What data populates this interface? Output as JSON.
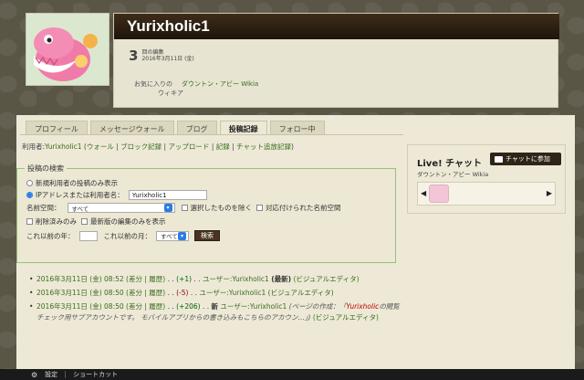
{
  "profile": {
    "username": "Yurixholic1",
    "edit_count": "3",
    "edit_label_line1": "回の編集",
    "edit_label_line2": "2016年3月11日 (金)",
    "favorite_label_line1": "お気に入りの",
    "favorite_label_line2": "ウィキア",
    "favorite_wiki": "ダウントン・アビー Wikia"
  },
  "tabs": [
    "プロフィール",
    "メッセージウォール",
    "ブログ",
    "投稿記録",
    "フォロー中"
  ],
  "active_tab": "投稿記録",
  "user_links": {
    "prefix": "利用者:",
    "user": "Yurixholic1",
    "paren_open": " (",
    "links": [
      "ウォール",
      "ブロック記録",
      "アップロード",
      "記録",
      "チャット追放記録"
    ],
    "separator": " | ",
    "paren_close": ")"
  },
  "search": {
    "legend": "投稿の検索",
    "option_new": "新規利用者の投稿のみ表示",
    "option_ip": "IPアドレスまたは利用者名：",
    "ip_value": "Yurixholic1",
    "namespace_label": "名前空間：",
    "namespace_value": "すべて",
    "invert_label": "選択したものを除く",
    "associated_label": "対応付けられた名前空間",
    "deleted_only_label": "削除済みのみ",
    "latest_only_label": "最新版の編集のみを表示",
    "year_label": "これ以前の年：",
    "month_label": "これ以前の月：",
    "month_value": "すべて",
    "submit_label": "検索"
  },
  "history": [
    {
      "date": "2016年3月11日 (金) 08:52",
      "links": "(差分 | 履歴)",
      "dots": " . . ",
      "size": "(+1)",
      "user": "ユーザー:Yurixholic1",
      "flag": "(最新)",
      "tool": "(ビジュアルエディタ)"
    },
    {
      "date": "2016年3月11日 (金) 08:50",
      "links": "(差分 | 履歴)",
      "dots": " . . ",
      "size": "(-5)",
      "user": "ユーザー:Yurixholic1",
      "flag": "",
      "tool": "(ビジュアルエディタ)"
    },
    {
      "date": "2016年3月11日 (金) 08:50",
      "links": "(差分 | 履歴)",
      "dots": " . . ",
      "size": "(+206)",
      "new_marker": "新",
      "user": "ユーザー:Yurixholic1",
      "comment_prefix": "(ページの作成：「",
      "comment_name": "Yurixholic",
      "comment_rest": "の閲覧チェック用サブアカウントです。 モバイルアプリからの書き込みもこちらのアカウン...」)",
      "tool": "(ビジュアルエディタ)"
    }
  ],
  "chat": {
    "title": "Live! チャット",
    "wiki": "ダウントン・アビー Wikia",
    "button": "チャットに参加"
  },
  "toolbar": {
    "settings": "設定",
    "shortcuts": "ショートカット"
  },
  "icons": {
    "settings": "gear-icon",
    "chat": "chat-bubble-icon",
    "prev": "chevron-left-icon",
    "next": "chevron-right-icon"
  },
  "colors": {
    "header_bar": "#2b1d10",
    "link": "#3a6b1f",
    "positive": "#006400",
    "negative": "#8b0000",
    "accent": "#2a7de1"
  }
}
